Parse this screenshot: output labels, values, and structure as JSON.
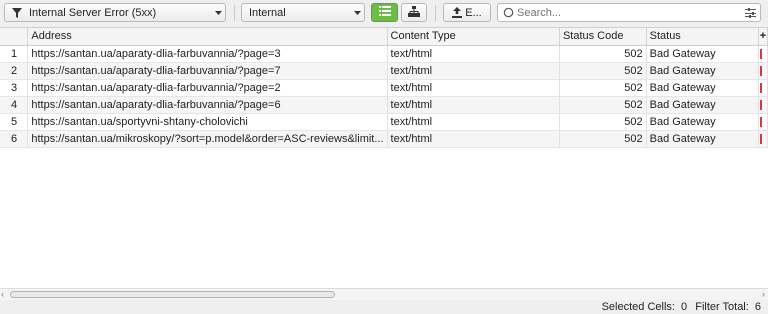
{
  "toolbar": {
    "filter_dropdown": "Internal Server Error (5xx)",
    "scope_dropdown": "Internal",
    "export_label": "E...",
    "search_placeholder": "Search..."
  },
  "table": {
    "columns": [
      "",
      "Address",
      "Content Type",
      "Status Code",
      "Status"
    ],
    "rows": [
      {
        "idx": "1",
        "address": "https://santan.ua/aparaty-dlia-farbuvannia/?page=3",
        "content_type": "text/html",
        "status_code": "502",
        "status": "Bad Gateway"
      },
      {
        "idx": "2",
        "address": "https://santan.ua/aparaty-dlia-farbuvannia/?page=7",
        "content_type": "text/html",
        "status_code": "502",
        "status": "Bad Gateway"
      },
      {
        "idx": "3",
        "address": "https://santan.ua/aparaty-dlia-farbuvannia/?page=2",
        "content_type": "text/html",
        "status_code": "502",
        "status": "Bad Gateway"
      },
      {
        "idx": "4",
        "address": "https://santan.ua/aparaty-dlia-farbuvannia/?page=6",
        "content_type": "text/html",
        "status_code": "502",
        "status": "Bad Gateway"
      },
      {
        "idx": "5",
        "address": "https://santan.ua/sportyvni-shtany-cholovichi",
        "content_type": "text/html",
        "status_code": "502",
        "status": "Bad Gateway"
      },
      {
        "idx": "6",
        "address": "https://santan.ua/mikroskopy/?sort=p.model&order=ASC-reviews&limit...",
        "content_type": "text/html",
        "status_code": "502",
        "status": "Bad Gateway"
      }
    ]
  },
  "statusbar": {
    "selected_label": "Selected Cells:",
    "selected_value": "0",
    "filter_label": "Filter Total:",
    "filter_value": "6"
  },
  "colors": {
    "active_view": "#6cbd45",
    "status_marker": "#d13b3b"
  },
  "icons": [
    "filter-icon",
    "chevron-down-icon",
    "list-view-icon",
    "tree-view-icon",
    "export-icon",
    "search-icon",
    "settings-sliders-icon",
    "add-column-icon"
  ]
}
